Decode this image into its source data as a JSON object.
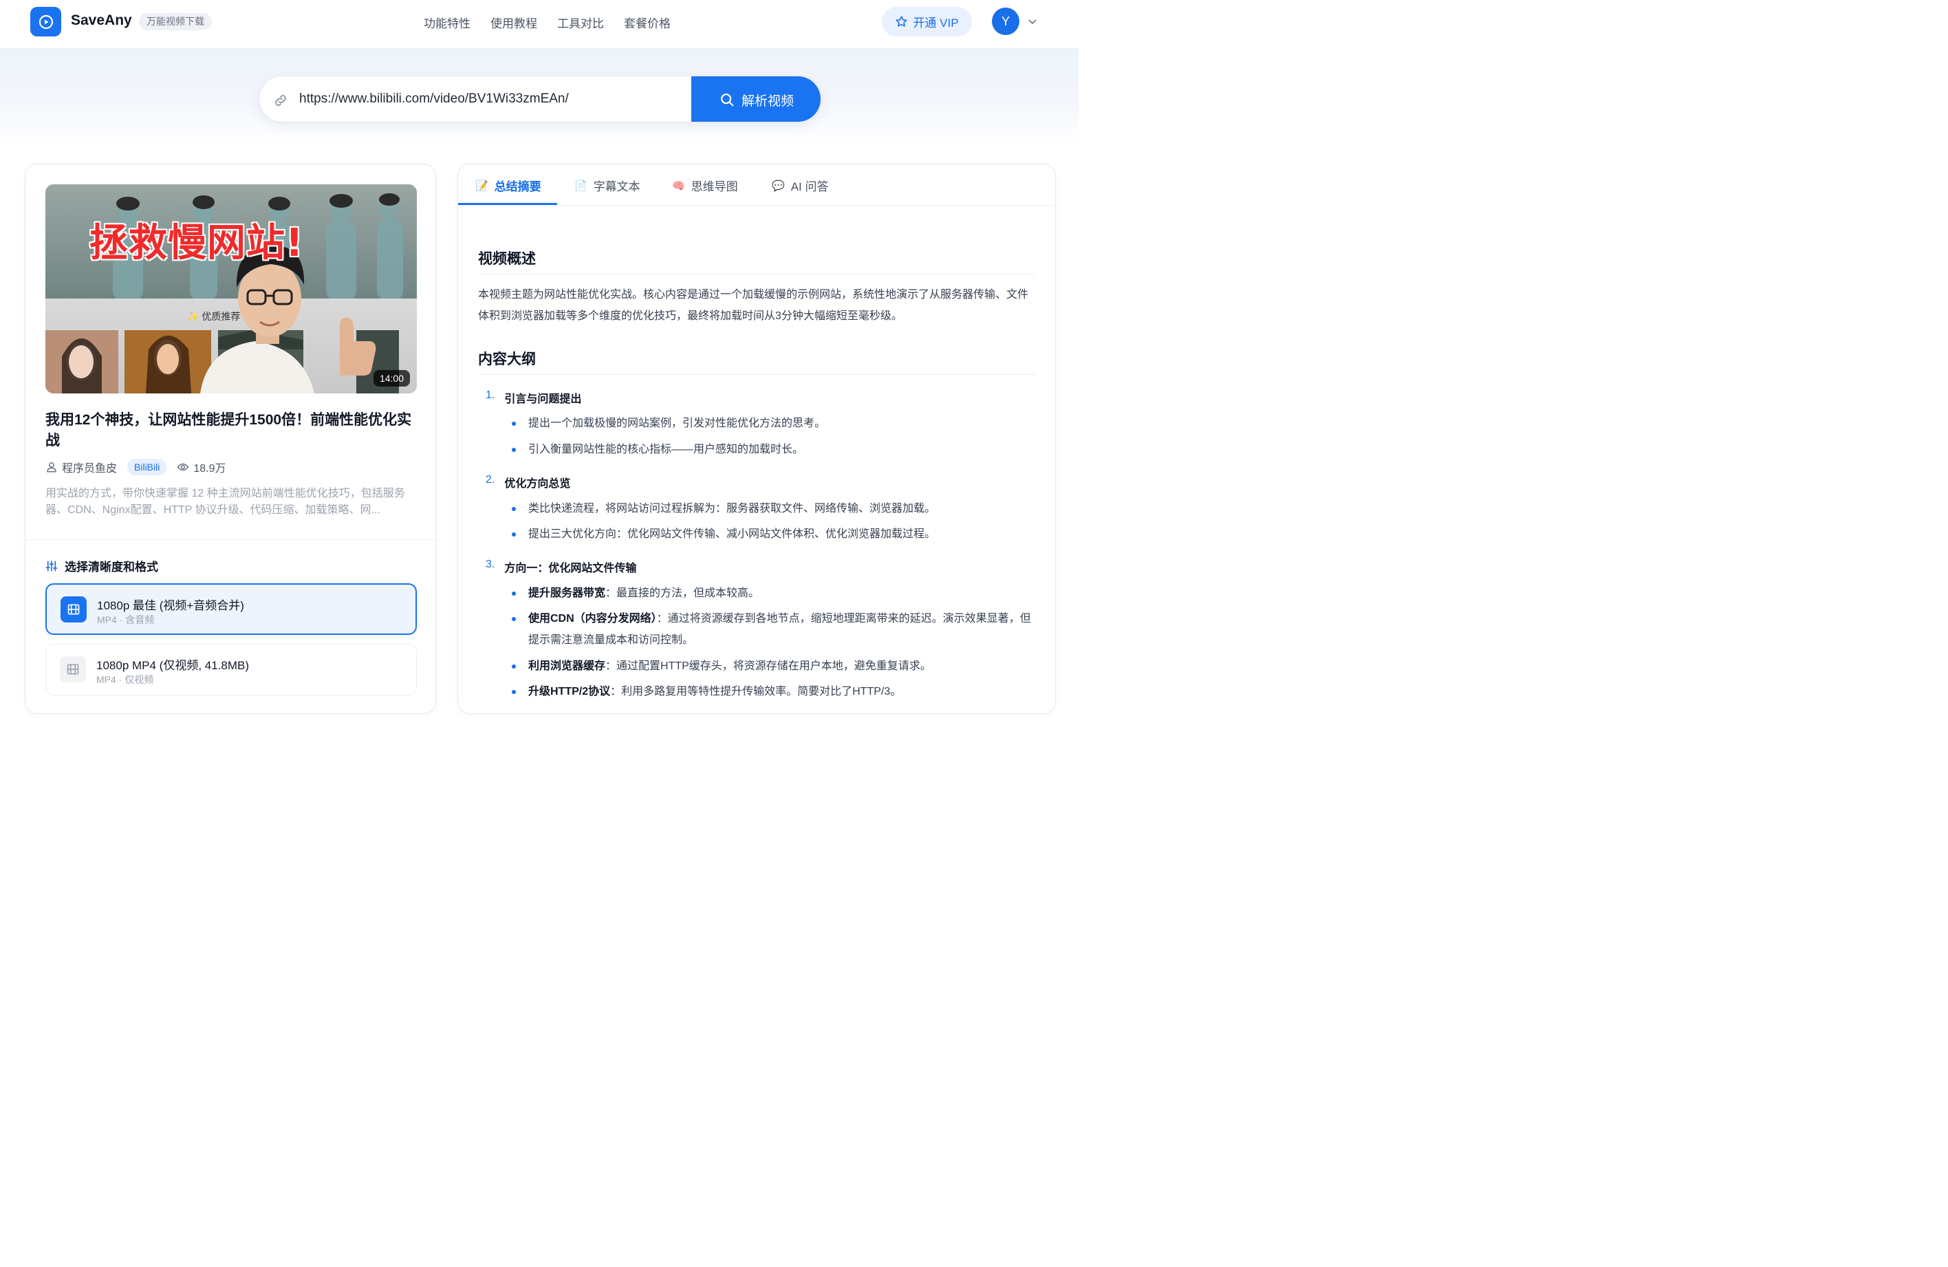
{
  "header": {
    "brand": "SaveAny",
    "tag": "万能视频下载",
    "nav": [
      "功能特性",
      "使用教程",
      "工具对比",
      "套餐价格"
    ],
    "vip_label": "开通 VIP",
    "avatar_letter": "Y"
  },
  "search": {
    "url_value": "https://www.bilibili.com/video/BV1Wi33zmEAn/",
    "button_label": "解析视频"
  },
  "video": {
    "thumbnail_headline": "拯救慢网站!",
    "thumbnail_badge": "✨ 优质推荐",
    "duration": "14:00",
    "title": "我用12个神技，让网站性能提升1500倍！前端性能优化实战",
    "author": "程序员鱼皮",
    "platform": "BiliBili",
    "views": "18.9万",
    "description": "用实战的方式，带你快速掌握 12 种主流网站前端性能优化技巧，包括服务器、CDN、Nginx配置、HTTP 协议升级、代码压缩、加载策略、网..."
  },
  "formats": {
    "heading": "选择清晰度和格式",
    "options": [
      {
        "title": "1080p 最佳 (视频+音频合并)",
        "subtitle": "MP4 · 含音频",
        "selected": true
      },
      {
        "title": "1080p MP4 (仅视频, 41.8MB)",
        "subtitle": "MP4 · 仅视频",
        "selected": false
      }
    ]
  },
  "tabs": [
    {
      "icon": "📝",
      "label": "总结摘要",
      "active": true
    },
    {
      "icon": "📄",
      "label": "字幕文本",
      "active": false
    },
    {
      "icon": "🧠",
      "label": "思维导图",
      "active": false
    },
    {
      "icon": "💬",
      "label": "AI 问答",
      "active": false
    }
  ],
  "summary": {
    "overview_heading": "视频概述",
    "overview_text": "本视频主题为网站性能优化实战。核心内容是通过一个加载缓慢的示例网站，系统性地演示了从服务器传输、文件体积到浏览器加载等多个维度的优化技巧，最终将加载时间从3分钟大幅缩短至毫秒级。",
    "outline_heading": "内容大纲",
    "outline": [
      {
        "num": "1.",
        "label": "引言与问题提出",
        "bullets": [
          {
            "bold": "",
            "text": "提出一个加载极慢的网站案例，引发对性能优化方法的思考。"
          },
          {
            "bold": "",
            "text": "引入衡量网站性能的核心指标——用户感知的加载时长。"
          }
        ]
      },
      {
        "num": "2.",
        "label": "优化方向总览",
        "bullets": [
          {
            "bold": "",
            "text": "类比快递流程，将网站访问过程拆解为：服务器获取文件、网络传输、浏览器加载。"
          },
          {
            "bold": "",
            "text": "提出三大优化方向：优化网站文件传输、减小网站文件体积、优化浏览器加载过程。"
          }
        ]
      },
      {
        "num": "3.",
        "label": "方向一：优化网站文件传输",
        "bullets": [
          {
            "bold": "提升服务器带宽",
            "text": "：最直接的方法，但成本较高。"
          },
          {
            "bold": "使用CDN（内容分发网络）",
            "text": "：通过将资源缓存到各地节点，缩短地理距离带来的延迟。演示效果显著，但提示需注意流量成本和访问控制。"
          },
          {
            "bold": "利用浏览器缓存",
            "text": "：通过配置HTTP缓存头，将资源存储在用户本地，避免重复请求。"
          },
          {
            "bold": "升级HTTP/2协议",
            "text": "：利用多路复用等特性提升传输效率。简要对比了HTTP/3。"
          }
        ]
      }
    ]
  }
}
